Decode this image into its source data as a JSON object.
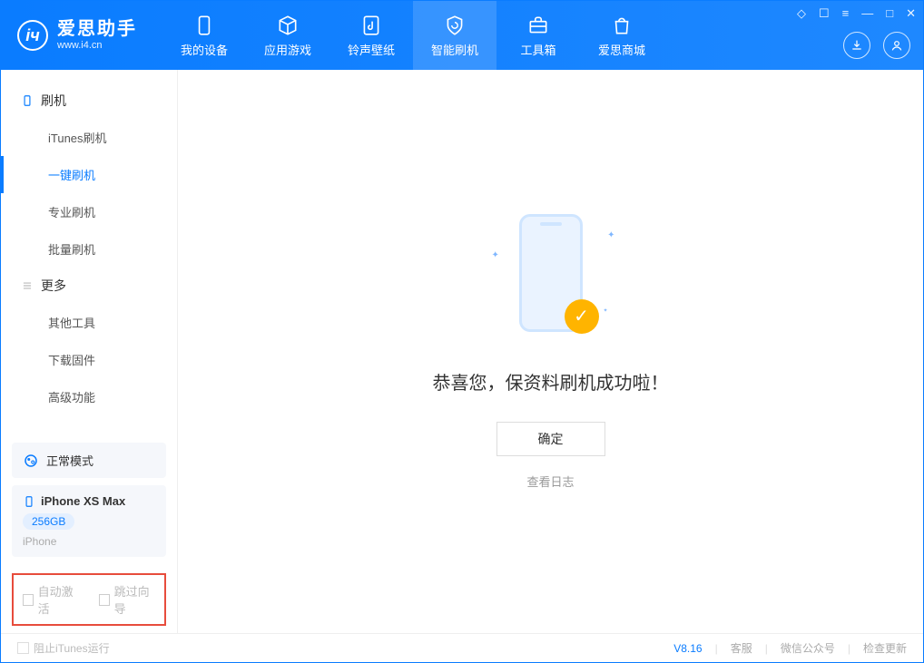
{
  "app": {
    "title": "爱思助手",
    "url": "www.i4.cn"
  },
  "tabs": {
    "device": "我的设备",
    "apps": "应用游戏",
    "ring": "铃声壁纸",
    "flash": "智能刷机",
    "toolbox": "工具箱",
    "store": "爱思商城"
  },
  "sidebar": {
    "section1": "刷机",
    "items1": [
      "iTunes刷机",
      "一键刷机",
      "专业刷机",
      "批量刷机"
    ],
    "section2": "更多",
    "items2": [
      "其他工具",
      "下载固件",
      "高级功能"
    ],
    "mode": "正常模式",
    "device": {
      "name": "iPhone XS Max",
      "storage": "256GB",
      "type": "iPhone"
    },
    "auto_activate": "自动激活",
    "skip_guide": "跳过向导"
  },
  "main": {
    "success": "恭喜您，保资料刷机成功啦！",
    "confirm": "确定",
    "view_log": "查看日志"
  },
  "footer": {
    "block_itunes": "阻止iTunes运行",
    "version": "V8.16",
    "support": "客服",
    "wechat": "微信公众号",
    "update": "检查更新"
  }
}
